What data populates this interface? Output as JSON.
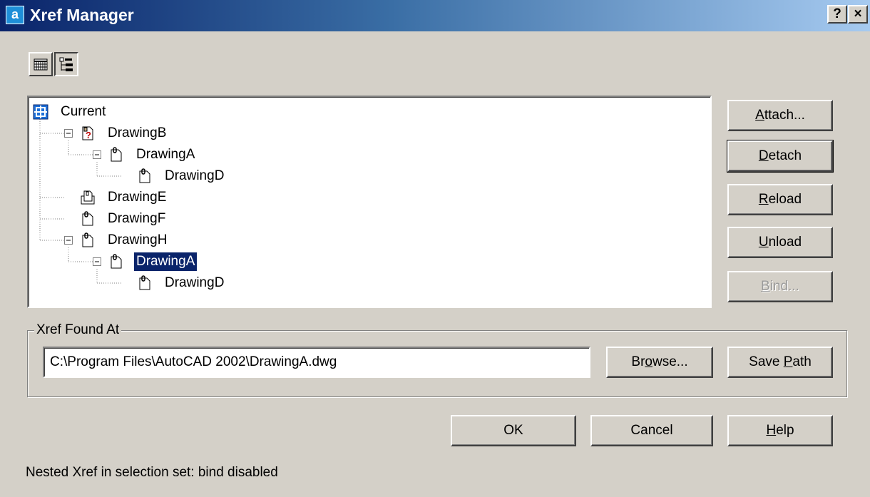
{
  "window": {
    "title": "Xref Manager",
    "help_glyph": "?",
    "close_glyph": "×",
    "app_glyph": "a"
  },
  "view_toggle": {
    "list_view_icon": "list-view-icon",
    "tree_view_icon": "tree-view-icon",
    "active": "tree"
  },
  "tree": {
    "nodes": [
      {
        "label": "Current",
        "icon": "current-drawing-icon",
        "level": 0,
        "expander": "none"
      },
      {
        "label": "DrawingB",
        "icon": "xref-not-found-icon",
        "level": 1,
        "expander": "minus"
      },
      {
        "label": "DrawingA",
        "icon": "xref-attach-icon",
        "level": 2,
        "expander": "minus"
      },
      {
        "label": "DrawingD",
        "icon": "xref-attach-icon",
        "level": 3,
        "expander": "none"
      },
      {
        "label": "DrawingE",
        "icon": "xref-overlay-icon",
        "level": 1,
        "expander": "none"
      },
      {
        "label": "DrawingF",
        "icon": "xref-attach-icon",
        "level": 1,
        "expander": "none"
      },
      {
        "label": "DrawingH",
        "icon": "xref-attach-icon",
        "level": 1,
        "expander": "minus"
      },
      {
        "label": "DrawingA",
        "icon": "xref-attach-icon",
        "level": 2,
        "expander": "minus",
        "selected": true
      },
      {
        "label": "DrawingD",
        "icon": "xref-attach-icon",
        "level": 3,
        "expander": "none"
      }
    ]
  },
  "side_buttons": {
    "attach": {
      "prefix": "",
      "mnemonic": "A",
      "rest": "ttach..."
    },
    "detach": {
      "prefix": "",
      "mnemonic": "D",
      "rest": "etach"
    },
    "reload": {
      "prefix": "",
      "mnemonic": "R",
      "rest": "eload"
    },
    "unload": {
      "prefix": "",
      "mnemonic": "U",
      "rest": "nload"
    },
    "bind": {
      "prefix": "",
      "mnemonic": "B",
      "rest": "ind...",
      "disabled": true
    }
  },
  "found_at": {
    "group_label": "Xref Found At",
    "path": "C:\\Program Files\\AutoCAD 2002\\DrawingA.dwg",
    "browse": {
      "prefix": "Br",
      "mnemonic": "o",
      "rest": "wse..."
    },
    "save_path": {
      "prefix": "Save ",
      "mnemonic": "P",
      "rest": "ath"
    }
  },
  "footer_buttons": {
    "ok": "OK",
    "cancel": "Cancel",
    "help": {
      "prefix": "",
      "mnemonic": "H",
      "rest": "elp"
    }
  },
  "status_text": "Nested Xref in selection set: bind disabled",
  "colors": {
    "face": "#d4d0c8",
    "title_start": "#0a246a",
    "selection": "#0a246a"
  }
}
